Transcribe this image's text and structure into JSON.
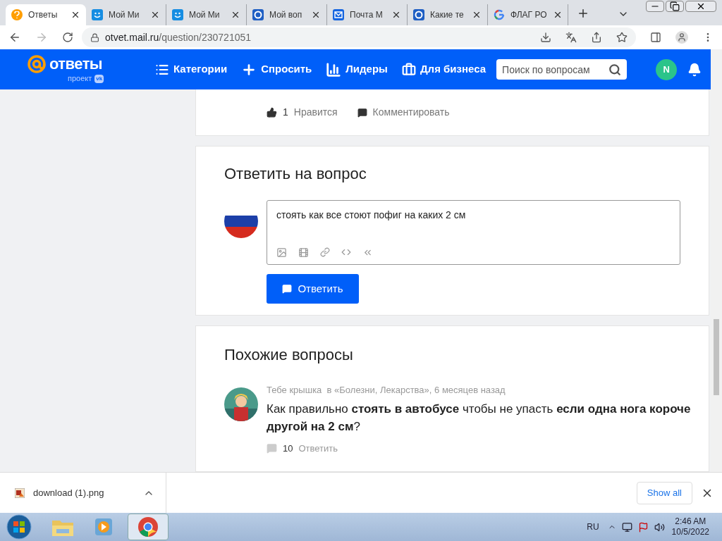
{
  "browser": {
    "tabs": [
      {
        "title": "Ответы",
        "kind": "question",
        "selected": true
      },
      {
        "title": "Мой Ми",
        "kind": "smile",
        "selected": false
      },
      {
        "title": "Мой Ми",
        "kind": "smile",
        "selected": false
      },
      {
        "title": "Мой воп",
        "kind": "ring",
        "selected": false
      },
      {
        "title": "Почта М",
        "kind": "mail",
        "selected": false
      },
      {
        "title": "Какие те",
        "kind": "ring",
        "selected": false
      },
      {
        "title": "ФЛАГ РО",
        "kind": "google",
        "selected": false
      }
    ],
    "url_host": "otvet.mail.ru",
    "url_path": "/question/230721051"
  },
  "header": {
    "logo": "ответы",
    "logo_sub": "проект",
    "logo_badge": "vk",
    "nav": [
      {
        "label": "Категории",
        "kind": "list"
      },
      {
        "label": "Спросить",
        "kind": "plus"
      },
      {
        "label": "Лидеры",
        "kind": "bars"
      },
      {
        "label": "Для бизнеса",
        "kind": "bag"
      }
    ],
    "search": {
      "placeholder": "Поиск по вопросам"
    },
    "avatar": "N"
  },
  "answer_actions": {
    "likes": "1",
    "like_label": "Нравится",
    "comment_label": "Комментировать"
  },
  "reply": {
    "title": "Ответить на вопрос",
    "value": "стоять как все стоют пофиг на каких 2 см",
    "button": "Ответить"
  },
  "similar": {
    "title": "Похожие вопросы",
    "items": [
      {
        "author": "Тебе крышка",
        "meta": "в «Болезни, Лекарства», 6 месяцев назад",
        "question": "Как правильно **стоять в автобусе** чтобы не упасть **если одна нога короче другой на 2 см**?",
        "count": "10",
        "action": "Ответить"
      }
    ]
  },
  "downloads": {
    "file": "download (1).png",
    "show_all": "Show all"
  },
  "taskbar": {
    "lang": "RU",
    "time": "2:46 AM",
    "date": "10/5/2022"
  }
}
